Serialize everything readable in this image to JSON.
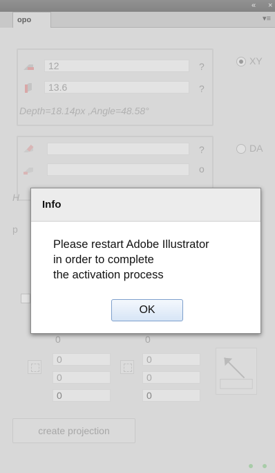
{
  "window": {
    "collapse_glyph": "«",
    "close_glyph": "×",
    "tab_label": "opo",
    "panel_menu_glyph": "▾≡"
  },
  "xy_section": {
    "width_value": "12",
    "width_unit": "?",
    "height_value": "13.6",
    "height_unit": "?",
    "summary": "Depth=18.14px ,Angle=48.58°",
    "radio_label": "XY",
    "radio_selected": true
  },
  "da_section": {
    "field1_unit": "?",
    "field2_unit": "o",
    "radio_label": "DA",
    "partial_label": "H",
    "partial_label2": "p"
  },
  "coords": {
    "top_left": "0",
    "top_right": "0",
    "left_col": [
      "0",
      "0",
      "0"
    ],
    "right_col": [
      "0",
      "0",
      "0"
    ]
  },
  "create_button": "create projection",
  "dialog": {
    "title": "Info",
    "message_lines": [
      "Please restart Adobe Illustrator",
      "in order to complete",
      "the activation process"
    ],
    "ok_label": "OK"
  },
  "colors": {
    "panel_bg": "#d6d6d6",
    "dialog_bg": "#ffffff",
    "ok_border": "#7d9fcc",
    "status_dot": "#5cb85c"
  }
}
